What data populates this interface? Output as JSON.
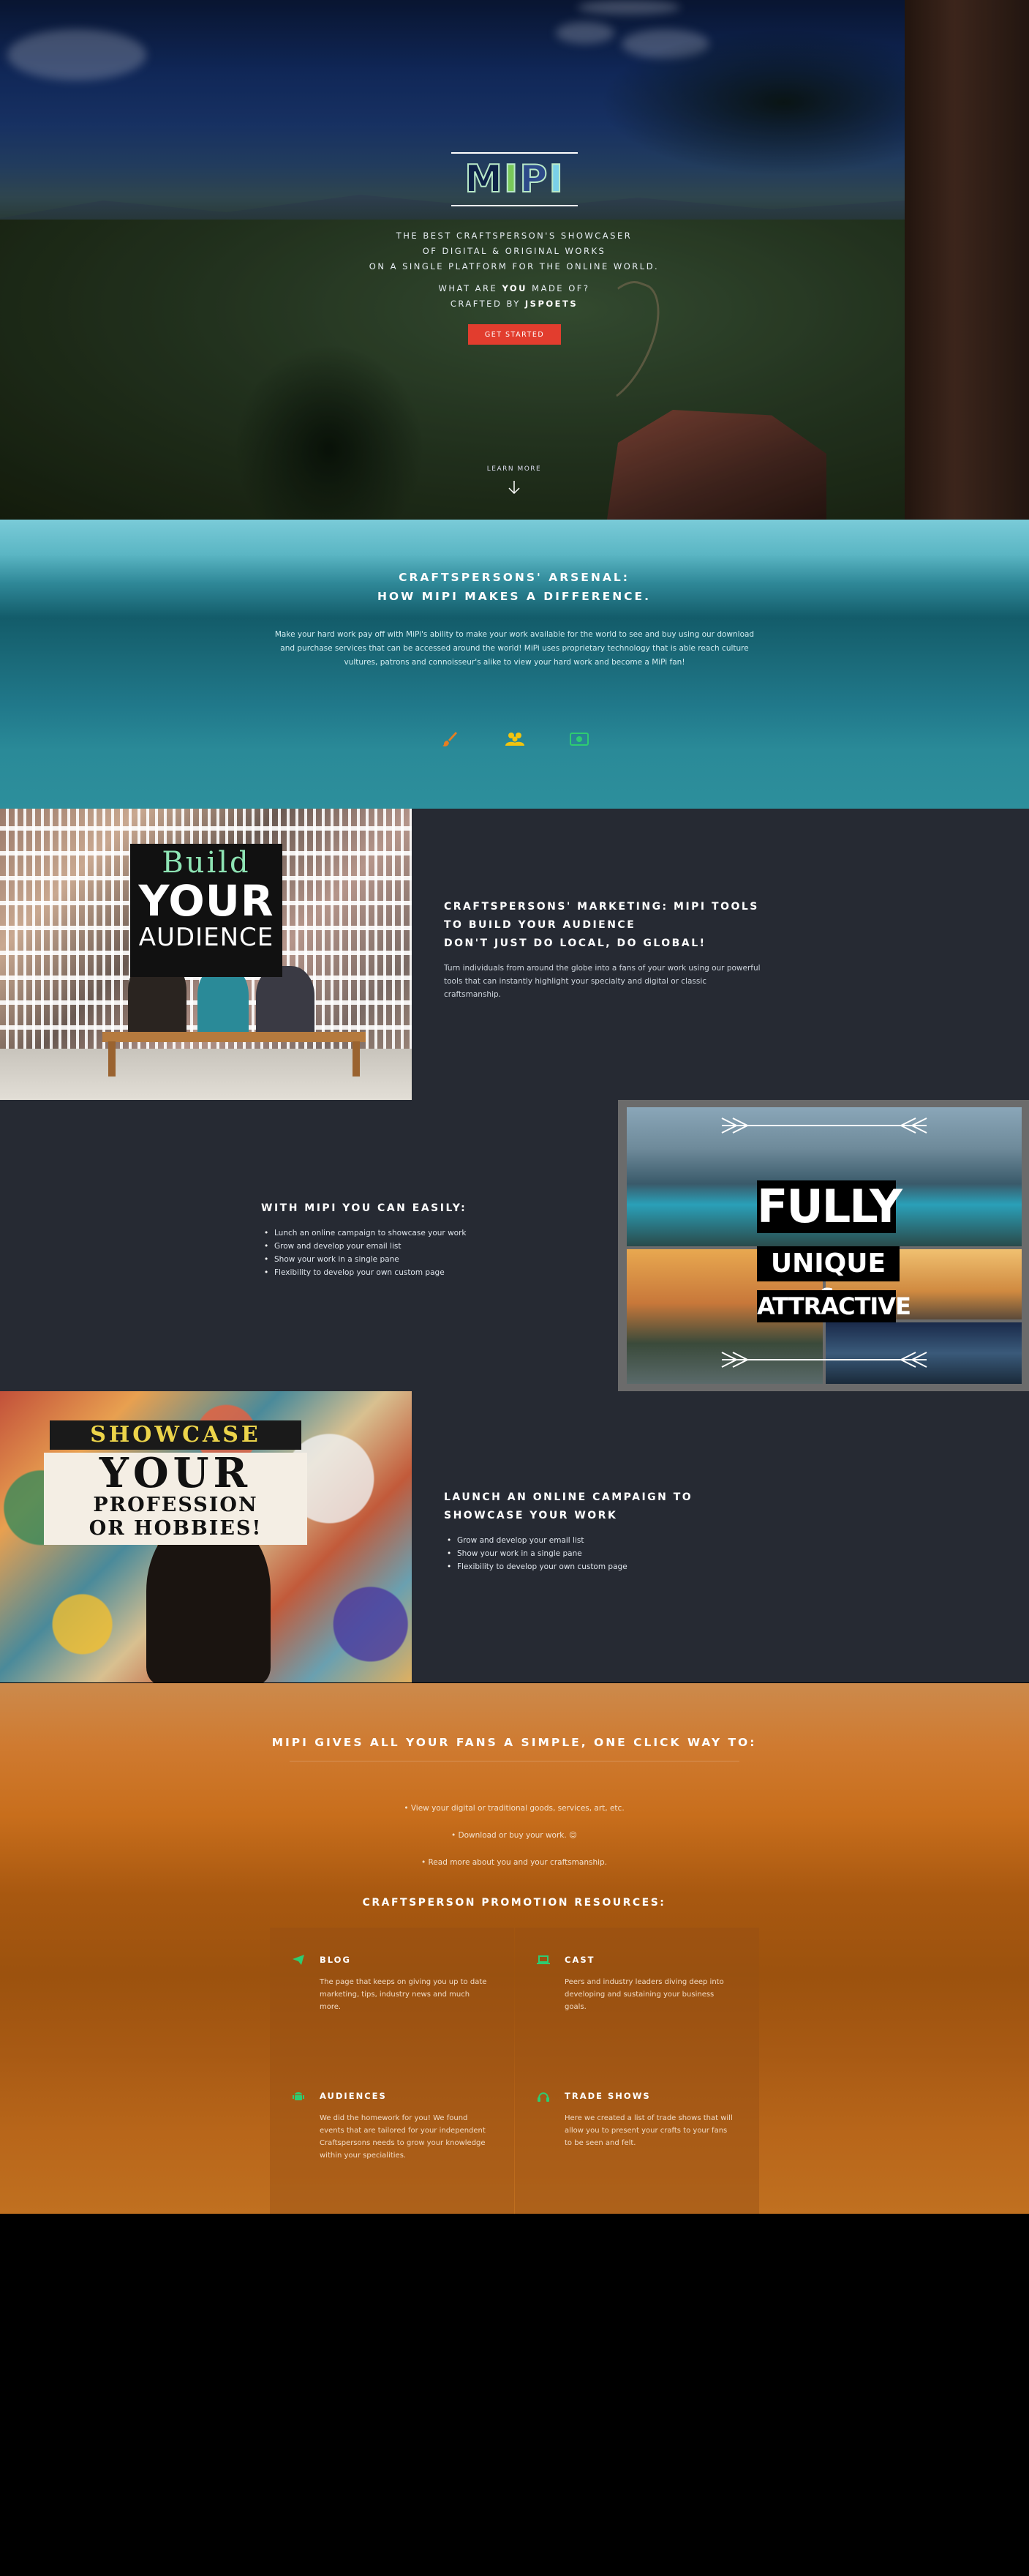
{
  "hero": {
    "logo": [
      "M",
      "I",
      "P",
      "I"
    ],
    "tagline": [
      "THE BEST CRAFTSPERSON'S SHOWCASER",
      "OF DIGITAL & ORIGINAL WORKS",
      "ON A SINGLE PLATFORM FOR THE ONLINE WORLD."
    ],
    "question_prefix": "WHAT ARE ",
    "question_you": "YOU",
    "question_suffix": " MADE OF?",
    "crafted_prefix": "CRAFTED BY ",
    "crafted_by": "JSPOETS",
    "cta_label": "GET STARTED",
    "learn_more": "LEARN MORE"
  },
  "arsenal": {
    "title_line1": "CRAFTSPERSONS' ARSENAL:",
    "title_line2": "HOW MIPI MAKES A DIFFERENCE.",
    "body": "Make your hard work pay off with MiPi's ability to make your work available for the world to see and buy using our download and purchase services that can be accessed around the world! MiPi uses proprietary technology that is able reach culture vultures, patrons and connoisseur's alike to view your hard work and become a MiPi fan!",
    "icons": [
      "paintbrush-icon",
      "users-icon",
      "money-icon"
    ],
    "icon_colors": [
      "#e67e22",
      "#f1c40f",
      "#2ecc71"
    ]
  },
  "marketing": {
    "title_lines": [
      "CRAFTSPERSONS' MARKETING: MIPI TOOLS",
      "TO BUILD YOUR AUDIENCE",
      "DON'T JUST DO LOCAL, DO GLOBAL!"
    ],
    "body": "Turn individuals from around the globe into a fans of your work using our powerful tools that can instantly highlight your specialty and digital or classic craftsmanship.",
    "image_words": [
      "Build",
      "YOUR",
      "AUDIENCE"
    ]
  },
  "easily": {
    "title": "WITH MIPI YOU CAN EASILY:",
    "items": [
      "Lunch an online campaign to showcase your work",
      "Grow and develop your email list",
      "Show your work in a single pane",
      "Flexibility to develop your own custom page"
    ],
    "image_words": [
      "FULLY",
      "UNIQUE &",
      "ATTRACTIVE"
    ]
  },
  "campaign": {
    "title_lines": [
      "LAUNCH AN ONLINE CAMPAIGN TO",
      "SHOWCASE YOUR WORK"
    ],
    "items": [
      "Grow and develop your email list",
      "Show your work in a single pane",
      "Flexibility to develop your own custom page"
    ],
    "image_words": [
      "SHOWCASE",
      "YOUR",
      "PROFESSION",
      "OR HOBBIES!"
    ]
  },
  "fans": {
    "title": "MIPI GIVES ALL YOUR FANS A SIMPLE, ONE CLICK WAY TO:",
    "lines": [
      "• View your digital or traditional goods, services, art, etc.",
      "• Download or buy your work. ☺",
      "• Read more about you and your craftsmanship."
    ],
    "resources_title": "CRAFTSPERSON PROMOTION RESOURCES:",
    "cards": [
      {
        "title": "BLOG",
        "icon": "paper-plane-icon",
        "body": "The page that keeps on giving you up to date marketing, tips, industry news and much more."
      },
      {
        "title": "CAST",
        "icon": "laptop-icon",
        "body": "Peers and industry leaders diving deep into developing and sustaining your business goals."
      },
      {
        "title": "AUDIENCES",
        "icon": "android-icon",
        "body": "We did the homework for you! We found events that are tailored for your independent Craftspersons needs to grow your knowledge within your specialities."
      },
      {
        "title": "TRADE SHOWS",
        "icon": "headphones-icon",
        "body": "Here we created a list of trade shows that will allow you to present your crafts to your fans to be seen and felt."
      }
    ],
    "icon_color": "#2ecc71"
  },
  "colors": {
    "cta": "#e23d2e",
    "dark_section": "#262a33",
    "teal": "#1a6978",
    "orange": "#c86e1c"
  }
}
